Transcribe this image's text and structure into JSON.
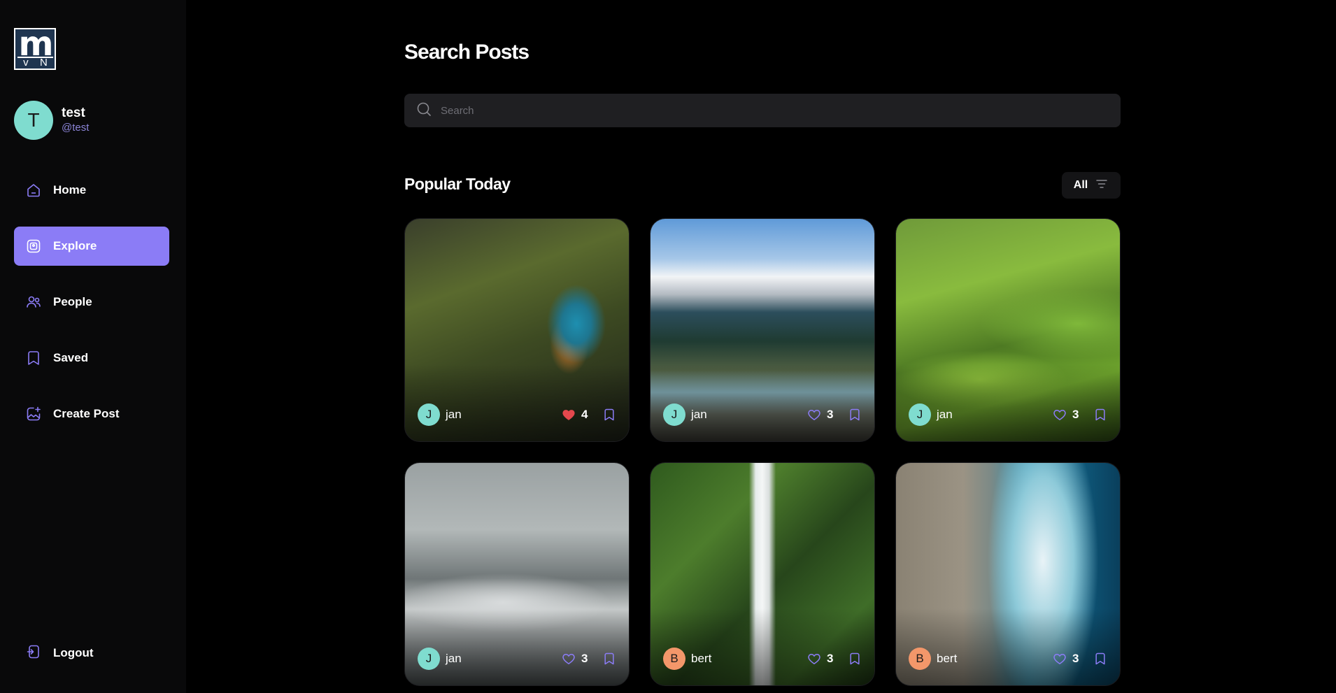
{
  "brand": {
    "logo_text": "m",
    "logo_sub_left": "v",
    "logo_sub_right": "N"
  },
  "user": {
    "initial": "T",
    "name": "test",
    "handle": "@test",
    "avatar_color": "#7fdccf"
  },
  "nav": {
    "items": [
      {
        "label": "Home",
        "icon": "home-icon",
        "active": false
      },
      {
        "label": "Explore",
        "icon": "explore-icon",
        "active": true
      },
      {
        "label": "People",
        "icon": "people-icon",
        "active": false
      },
      {
        "label": "Saved",
        "icon": "bookmark-icon",
        "active": false
      },
      {
        "label": "Create Post",
        "icon": "create-post-icon",
        "active": false
      }
    ],
    "logout_label": "Logout"
  },
  "main": {
    "title": "Search Posts",
    "search": {
      "placeholder": "Search",
      "value": ""
    },
    "section_title": "Popular Today",
    "filter_label": "All"
  },
  "posts": [
    {
      "image": "kingfisher",
      "author_initial": "J",
      "author": "jan",
      "avatar_color": "#7fdccf",
      "likes": "4",
      "liked": true
    },
    {
      "image": "river",
      "author_initial": "J",
      "author": "jan",
      "avatar_color": "#7fdccf",
      "likes": "3",
      "liked": false
    },
    {
      "image": "hills",
      "author_initial": "J",
      "author": "jan",
      "avatar_color": "#7fdccf",
      "likes": "3",
      "liked": false
    },
    {
      "image": "fog",
      "author_initial": "J",
      "author": "jan",
      "avatar_color": "#7fdccf",
      "likes": "3",
      "liked": false
    },
    {
      "image": "waterfall",
      "author_initial": "B",
      "author": "bert",
      "avatar_color": "#f3976a",
      "likes": "3",
      "liked": false
    },
    {
      "image": "ocean",
      "author_initial": "B",
      "author": "bert",
      "avatar_color": "#f3976a",
      "likes": "3",
      "liked": false
    }
  ],
  "colors": {
    "accent": "#8b7cf6",
    "like_active": "#e5484d",
    "background": "#000000",
    "sidebar": "#09090a"
  }
}
